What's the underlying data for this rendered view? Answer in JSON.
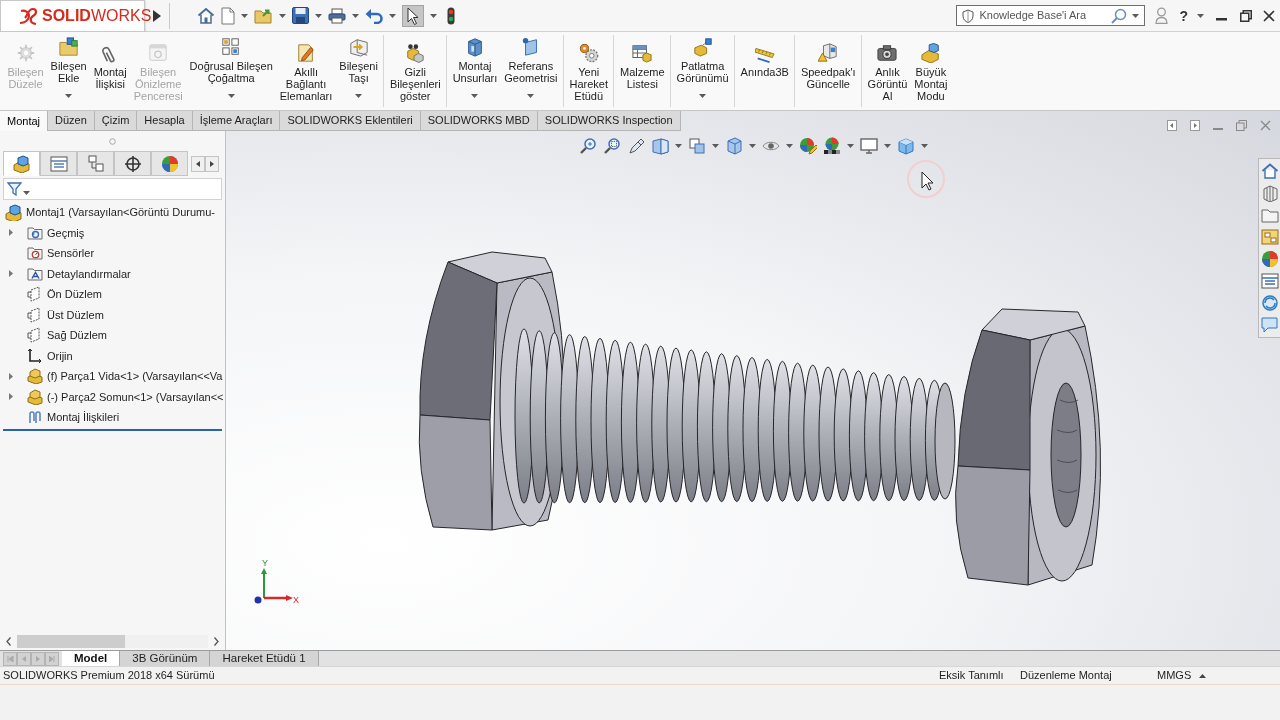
{
  "title_bar": {
    "logo": "**SOLID**WORKS",
    "select_tool_pressed": true,
    "search": {
      "placeholder": "Knowledge Base'i Ara"
    },
    "help": "?"
  },
  "ribbon_groups": [
    {
      "buttons": [
        {
          "label": "Bileşen\nDüzele",
          "disabled": true,
          "dropdown": false
        },
        {
          "label": "Bileşen\nEkle",
          "disabled": false,
          "dropdown": true
        },
        {
          "label": "Montaj\nİlişkisi",
          "disabled": false,
          "dropdown": false
        },
        {
          "label": "Bileşen\nÖnizleme\nPenceresi",
          "disabled": true,
          "dropdown": false
        },
        {
          "label": "Doğrusal Bileşen\nÇoğaltma",
          "disabled": false,
          "dropdown": true
        },
        {
          "label": "Akıllı\nBağlantı\nElemanları",
          "disabled": false,
          "dropdown": false
        },
        {
          "label": "Bileşeni\nTaşı",
          "disabled": false,
          "dropdown": true
        }
      ]
    },
    {
      "buttons": [
        {
          "label": "Gizli\nBileşenleri\ngöster",
          "disabled": false,
          "dropdown": false
        }
      ]
    },
    {
      "buttons": [
        {
          "label": "Montaj\nUnsurları",
          "disabled": false,
          "dropdown": true
        },
        {
          "label": "Referans\nGeometrisi",
          "disabled": false,
          "dropdown": true
        }
      ]
    },
    {
      "buttons": [
        {
          "label": "Yeni\nHareket\nEtüdü",
          "disabled": false,
          "dropdown": false
        }
      ]
    },
    {
      "buttons": [
        {
          "label": "Malzeme\nListesi",
          "disabled": false,
          "dropdown": false
        }
      ]
    },
    {
      "buttons": [
        {
          "label": "Patlatma\nGörünümü",
          "disabled": false,
          "dropdown": true
        }
      ]
    },
    {
      "buttons": [
        {
          "label": "Anında3B",
          "disabled": false,
          "dropdown": false
        }
      ]
    },
    {
      "buttons": [
        {
          "label": "Speedpak'ı\nGüncelle",
          "disabled": false,
          "dropdown": false
        }
      ]
    },
    {
      "buttons": [
        {
          "label": "Anlık\nGörüntü\nAl",
          "disabled": false,
          "dropdown": false
        },
        {
          "label": "Büyük\nMontaj\nModu",
          "disabled": false,
          "dropdown": false
        }
      ]
    }
  ],
  "command_tabs": [
    {
      "label": "Montaj",
      "selected": true
    },
    {
      "label": "Düzen",
      "selected": false
    },
    {
      "label": "Çizim",
      "selected": false
    },
    {
      "label": "Hesapla",
      "selected": false
    },
    {
      "label": "İşleme Araçları",
      "selected": false
    },
    {
      "label": "SOLIDWORKS Eklentileri",
      "selected": false
    },
    {
      "label": "SOLIDWORKS MBD",
      "selected": false
    },
    {
      "label": "SOLIDWORKS Inspection",
      "selected": false
    }
  ],
  "feature_manager": {
    "panel_tabs": [
      {
        "selected": true
      },
      {
        "selected": false
      },
      {
        "selected": false
      },
      {
        "selected": false
      },
      {
        "selected": false
      }
    ],
    "tree": {
      "label": "Montaj1 (Varsayılan<Görüntü Durumu-",
      "children": [
        {
          "label": "Geçmiş",
          "expandable": true
        },
        {
          "label": "Sensörler",
          "expandable": false
        },
        {
          "label": "Detaylandırmalar",
          "expandable": true
        },
        {
          "label": "Ön Düzlem",
          "expandable": false
        },
        {
          "label": "Üst Düzlem",
          "expandable": false
        },
        {
          "label": "Sağ Düzlem",
          "expandable": false
        },
        {
          "label": "Orijin",
          "expandable": false
        },
        {
          "label": "(f) Parça1 Vida<1> (Varsayılan<<Va",
          "expandable": true
        },
        {
          "label": "(-) Parça2 Somun<1> (Varsayılan<<",
          "expandable": true
        },
        {
          "label": "Montaj İlişkileri",
          "expandable": false
        }
      ]
    }
  },
  "graphics": {
    "triad": {
      "y_label": "Y",
      "x_label": "X"
    }
  },
  "view_tabs": [
    {
      "label": "Model",
      "selected": true
    },
    {
      "label": "3B Görünüm",
      "selected": false
    },
    {
      "label": "Hareket Etüdü 1",
      "selected": false
    }
  ],
  "status_bar": {
    "text": "SOLIDWORKS Premium 2018 x64 Sürümü",
    "fields": [
      "Eksik Tanımlı",
      "Düzenleme Montaj",
      "MMGS"
    ]
  }
}
